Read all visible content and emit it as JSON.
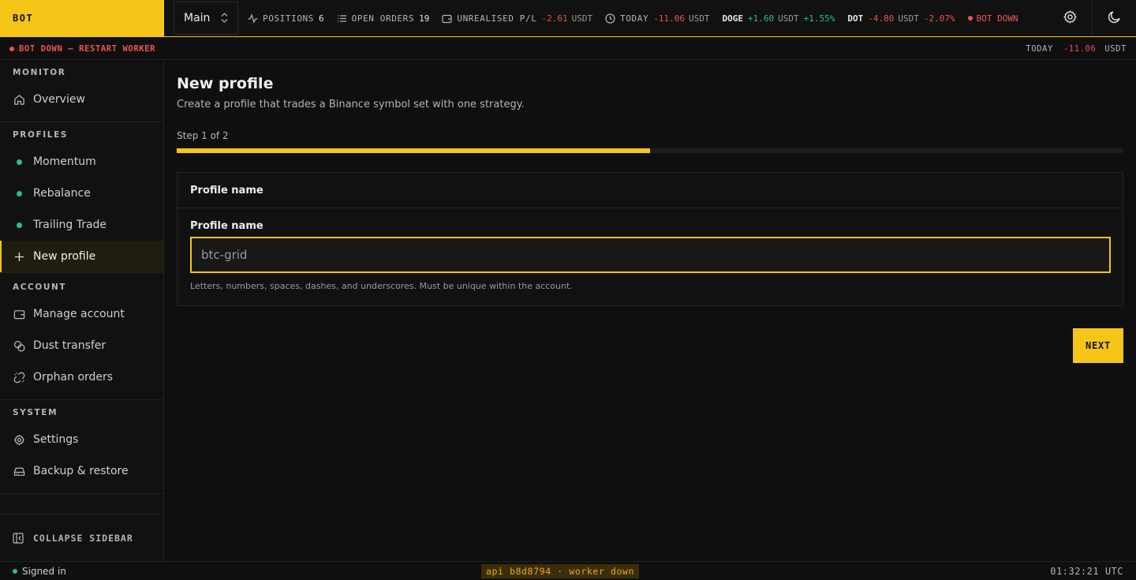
{
  "brand": "BOT",
  "account_select": {
    "value": "Main"
  },
  "topbar": {
    "positions": {
      "label": "POSITIONS",
      "value": "6"
    },
    "open_orders": {
      "label": "OPEN ORDERS",
      "value": "19"
    },
    "unrealised": {
      "label": "UNREALISED P/L",
      "value": "-2.61",
      "unit": "USDT"
    },
    "today": {
      "label": "TODAY",
      "value": "-11.06",
      "unit": "USDT"
    },
    "doge": {
      "symbol": "DOGE",
      "value": "+1.60",
      "unit": "USDT",
      "pct": "+1.55%"
    },
    "dot": {
      "symbol": "DOT",
      "value": "-4.80",
      "unit": "USDT",
      "pct": "-2.07%"
    },
    "bot_status": "BOT DOWN"
  },
  "alert": {
    "message": "BOT DOWN — RESTART WORKER",
    "today_label": "TODAY",
    "today_value": "-11.06",
    "today_unit": "USDT"
  },
  "sidebar": {
    "monitor": {
      "title": "MONITOR",
      "items": [
        "Overview"
      ]
    },
    "profiles": {
      "title": "PROFILES",
      "items": [
        "Momentum",
        "Rebalance",
        "Trailing Trade"
      ],
      "new_label": "New profile"
    },
    "account": {
      "title": "ACCOUNT",
      "items": [
        "Manage account",
        "Dust transfer",
        "Orphan orders"
      ]
    },
    "system": {
      "title": "SYSTEM",
      "items": [
        "Settings",
        "Backup & restore"
      ]
    },
    "collapse_label": "COLLAPSE SIDEBAR"
  },
  "main": {
    "title": "New profile",
    "subtitle": "Create a profile that trades a Binance symbol set with one strategy.",
    "step_label": "Step 1 of 2",
    "progress_fraction": 0.5,
    "card_title": "Profile name",
    "field_label": "Profile name",
    "field_placeholder": "btc-grid",
    "field_value": "",
    "field_help": "Letters, numbers, spaces, dashes, and underscores. Must be unique within the account.",
    "next_label": "NEXT"
  },
  "statusbar": {
    "signed_in": "Signed in",
    "pill": "api b8d8794 · worker down",
    "time": "01:32:21 UTC"
  },
  "colors": {
    "accent": "#f5c518",
    "negative": "#ef5350",
    "positive": "#26c281"
  }
}
